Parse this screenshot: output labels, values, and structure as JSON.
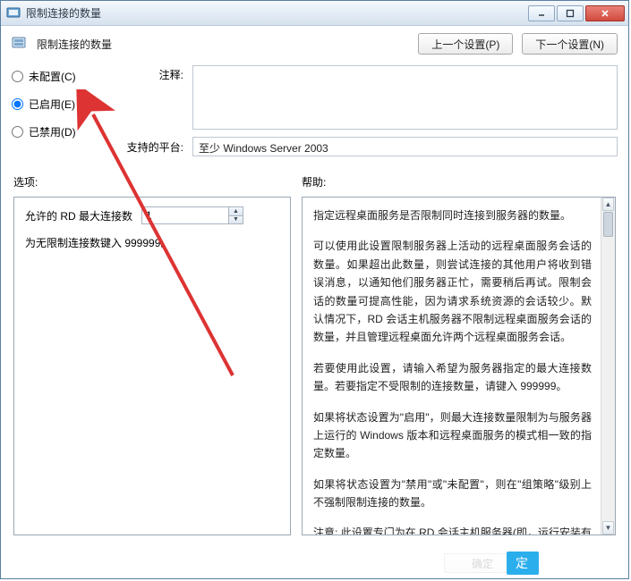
{
  "window": {
    "title": "限制连接的数量"
  },
  "toolbar": {
    "title": "限制连接的数量",
    "prev_label": "上一个设置(P)",
    "next_label": "下一个设置(N)"
  },
  "radios": {
    "not_configured": "未配置(C)",
    "enabled": "已启用(E)",
    "disabled": "已禁用(D)",
    "selected": "enabled"
  },
  "comment": {
    "label": "注释:",
    "value": ""
  },
  "platform": {
    "label": "支持的平台:",
    "value": "至少 Windows Server 2003"
  },
  "headers": {
    "options": "选项:",
    "help": "帮助:"
  },
  "options": {
    "max_conn_label": "允许的 RD 最大连接数",
    "max_conn_value": "1",
    "hint": "为无限制连接数键入 999999。"
  },
  "help": {
    "p1": "指定远程桌面服务是否限制同时连接到服务器的数量。",
    "p2": "可以使用此设置限制服务器上活动的远程桌面服务会话的数量。如果超出此数量，则尝试连接的其他用户将收到错误消息，以通知他们服务器正忙，需要稍后再试。限制会话的数量可提高性能，因为请求系统资源的会话较少。默认情况下，RD 会话主机服务器不限制远程桌面服务会话的数量，并且管理远程桌面允许两个远程桌面服务会话。",
    "p3": "若要使用此设置，请输入希望为服务器指定的最大连接数量。若要指定不受限制的连接数量，请键入 999999。",
    "p4": "如果将状态设置为\"启用\"，则最大连接数量限制为与服务器上运行的 Windows 版本和远程桌面服务的模式相一致的指定数量。",
    "p5": "如果将状态设置为\"禁用\"或\"未配置\"，则在\"组策略\"级别上不强制限制连接的数量。",
    "p6": "注意: 此设置专门为在 RD 会话主机服务器(即，运行安装有远程桌"
  },
  "bottom": {
    "ok_label": "确定"
  }
}
